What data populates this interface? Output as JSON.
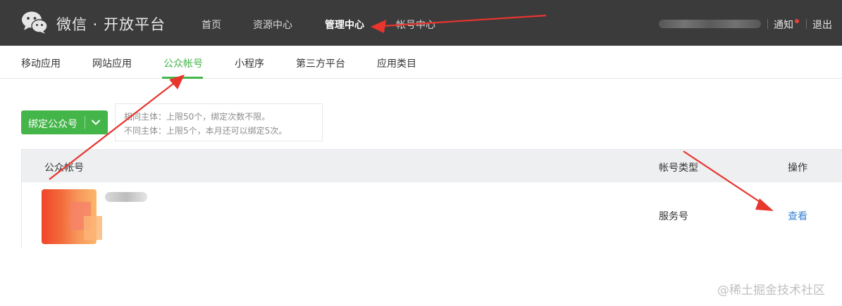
{
  "header": {
    "brand": "微信 · 开放平台",
    "nav": [
      {
        "label": "首页"
      },
      {
        "label": "资源中心"
      },
      {
        "label": "管理中心"
      },
      {
        "label": "帐号中心"
      }
    ],
    "active_nav": "管理中心",
    "notify_label": "通知",
    "logout_label": "退出"
  },
  "subnav": {
    "items": [
      {
        "label": "移动应用"
      },
      {
        "label": "网站应用"
      },
      {
        "label": "公众帐号"
      },
      {
        "label": "小程序"
      },
      {
        "label": "第三方平台"
      },
      {
        "label": "应用类目"
      }
    ],
    "active": "公众帐号"
  },
  "bind": {
    "button_label": "绑定公众号",
    "tips": [
      "相同主体：上限50个，绑定次数不限。",
      "不同主体：上限5个，本月还可以绑定5次。"
    ]
  },
  "table": {
    "headers": {
      "account": "公众帐号",
      "type": "帐号类型",
      "action": "操作"
    },
    "rows": [
      {
        "type": "服务号",
        "action": "查看"
      }
    ]
  },
  "watermark": "@稀土掘金技术社区",
  "colors": {
    "topbar_bg": "#3b3b3b",
    "accent_green": "#44b549",
    "link_blue": "#3b84d2",
    "annotation_red": "#e8352e"
  }
}
